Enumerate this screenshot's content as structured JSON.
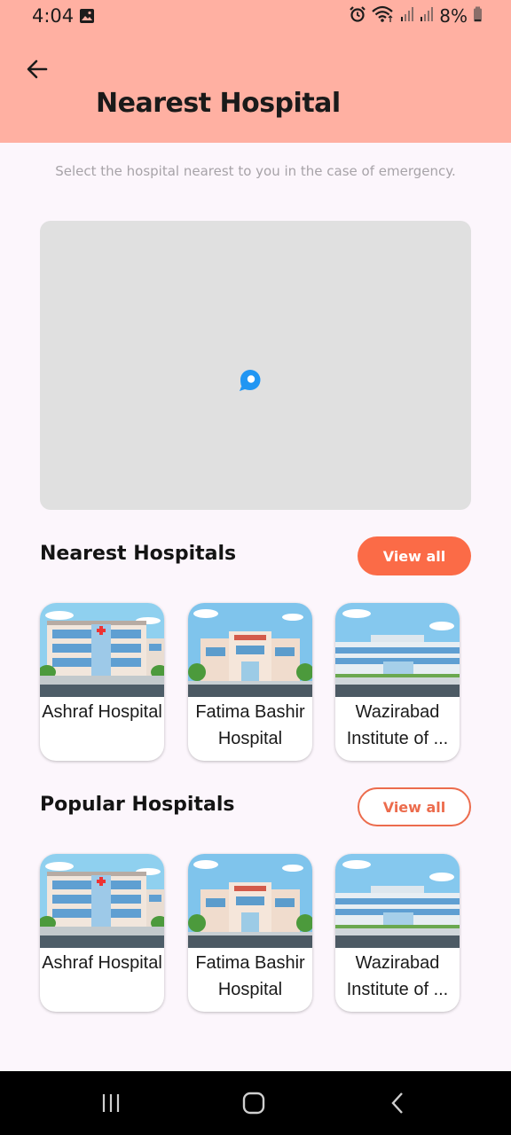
{
  "status_bar": {
    "time": "4:04",
    "battery": "8%",
    "icons": [
      "gallery-icon",
      "alarm-icon",
      "wifi-icon",
      "signal-icon",
      "signal-icon",
      "battery-icon"
    ]
  },
  "header": {
    "back_icon": "arrow-left-icon",
    "title": "Nearest Hospital",
    "background": "#ffb0a2"
  },
  "subtitle": "Select the hospital nearest to you in the case of emergency.",
  "map": {
    "pin_icon": "location-pin-icon",
    "pin_color": "#2196f3"
  },
  "nearest": {
    "title": "Nearest Hospitals",
    "view_all": "View all",
    "items": [
      {
        "name": "Ashraf Hospital"
      },
      {
        "name": "Fatima Bashir Hospital"
      },
      {
        "name": "Wazirabad Institute of ..."
      }
    ]
  },
  "popular": {
    "title": "Popular Hospitals",
    "view_all": "View all",
    "items": [
      {
        "name": "Ashraf Hospital"
      },
      {
        "name": "Fatima Bashir Hospital"
      },
      {
        "name": "Wazirabad Institute of ..."
      }
    ]
  },
  "colors": {
    "accent": "#fb6b47",
    "outline": "#ec6c4d",
    "page_bg": "#fcf6fc"
  },
  "nav_bar": {
    "icons": [
      "recents-icon",
      "home-icon",
      "back-icon"
    ]
  }
}
